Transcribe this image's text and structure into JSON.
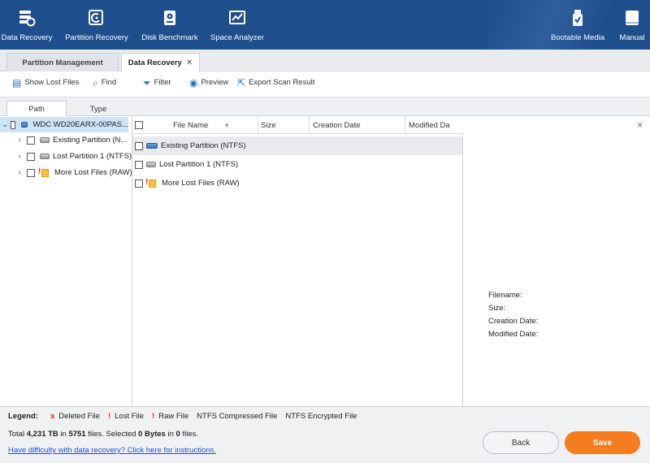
{
  "toolbar": {
    "data_recovery": "Data Recovery",
    "partition_recovery": "Partition Recovery",
    "disk_benchmark": "Disk Benchmark",
    "space_analyzer": "Space Analyzer",
    "bootable_media": "Bootable Media",
    "manual": "Manual"
  },
  "tabs": {
    "partition_management": "Partition Management",
    "data_recovery": "Data Recovery",
    "close": "✕"
  },
  "actions": {
    "show_lost_files": "Show Lost Files",
    "find": "Find",
    "filter": "Filter",
    "preview": "Preview",
    "export_scan_result": "Export Scan Result"
  },
  "view_tabs": {
    "path": "Path",
    "type": "Type"
  },
  "tree": {
    "root": "WDC WD20EARX-00PAS...",
    "items": [
      {
        "label": "Existing Partition (N..."
      },
      {
        "label": "Lost Partition 1 (NTFS)"
      },
      {
        "label": "More Lost Files (RAW)"
      }
    ]
  },
  "file_list": {
    "columns": {
      "file_name": "File Name",
      "size": "Size",
      "creation_date": "Creation Date",
      "modified_date": "Modified Da"
    },
    "rows": [
      {
        "name": "Existing Partition (NTFS)"
      },
      {
        "name": "Lost Partition 1 (NTFS)"
      },
      {
        "name": "More Lost Files (RAW)"
      }
    ]
  },
  "details": {
    "close": "×",
    "filename": "Filename:",
    "size": "Size:",
    "creation_date": "Creation Date:",
    "modified_date": "Modified Date:"
  },
  "legend": {
    "title": "Legend:",
    "deleted_mark": "x",
    "deleted": "Deleted File",
    "lost_mark": "!",
    "lost": "Lost File",
    "raw_mark": "!",
    "raw": "Raw File",
    "compressed": "NTFS Compressed File",
    "encrypted": "NTFS Encrypted File"
  },
  "summary": {
    "prefix": "Total ",
    "total_size": "4,231 TB",
    "in1": " in ",
    "file_count": "5751",
    "mid": " files.  Selected ",
    "selected_size": "0 Bytes",
    "in2": " in ",
    "selected_count": "0",
    "suffix": " files."
  },
  "help_link": "Have difficulty with data recovery? Click here for instructions.",
  "buttons": {
    "back": "Back",
    "save": "Save"
  },
  "colors": {
    "topbar": "#1f4e8c",
    "save_button": "#f57c1f",
    "selection": "#cde4f7"
  }
}
